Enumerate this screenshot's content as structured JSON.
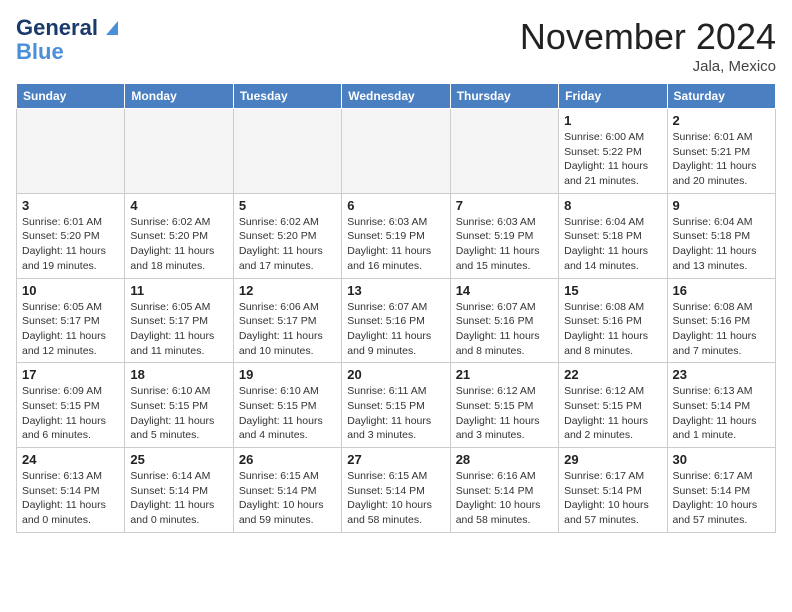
{
  "header": {
    "logo_line1": "General",
    "logo_line2": "Blue",
    "month": "November 2024",
    "location": "Jala, Mexico"
  },
  "weekdays": [
    "Sunday",
    "Monday",
    "Tuesday",
    "Wednesday",
    "Thursday",
    "Friday",
    "Saturday"
  ],
  "weeks": [
    [
      {
        "day": "",
        "info": ""
      },
      {
        "day": "",
        "info": ""
      },
      {
        "day": "",
        "info": ""
      },
      {
        "day": "",
        "info": ""
      },
      {
        "day": "",
        "info": ""
      },
      {
        "day": "1",
        "info": "Sunrise: 6:00 AM\nSunset: 5:22 PM\nDaylight: 11 hours\nand 21 minutes."
      },
      {
        "day": "2",
        "info": "Sunrise: 6:01 AM\nSunset: 5:21 PM\nDaylight: 11 hours\nand 20 minutes."
      }
    ],
    [
      {
        "day": "3",
        "info": "Sunrise: 6:01 AM\nSunset: 5:20 PM\nDaylight: 11 hours\nand 19 minutes."
      },
      {
        "day": "4",
        "info": "Sunrise: 6:02 AM\nSunset: 5:20 PM\nDaylight: 11 hours\nand 18 minutes."
      },
      {
        "day": "5",
        "info": "Sunrise: 6:02 AM\nSunset: 5:20 PM\nDaylight: 11 hours\nand 17 minutes."
      },
      {
        "day": "6",
        "info": "Sunrise: 6:03 AM\nSunset: 5:19 PM\nDaylight: 11 hours\nand 16 minutes."
      },
      {
        "day": "7",
        "info": "Sunrise: 6:03 AM\nSunset: 5:19 PM\nDaylight: 11 hours\nand 15 minutes."
      },
      {
        "day": "8",
        "info": "Sunrise: 6:04 AM\nSunset: 5:18 PM\nDaylight: 11 hours\nand 14 minutes."
      },
      {
        "day": "9",
        "info": "Sunrise: 6:04 AM\nSunset: 5:18 PM\nDaylight: 11 hours\nand 13 minutes."
      }
    ],
    [
      {
        "day": "10",
        "info": "Sunrise: 6:05 AM\nSunset: 5:17 PM\nDaylight: 11 hours\nand 12 minutes."
      },
      {
        "day": "11",
        "info": "Sunrise: 6:05 AM\nSunset: 5:17 PM\nDaylight: 11 hours\nand 11 minutes."
      },
      {
        "day": "12",
        "info": "Sunrise: 6:06 AM\nSunset: 5:17 PM\nDaylight: 11 hours\nand 10 minutes."
      },
      {
        "day": "13",
        "info": "Sunrise: 6:07 AM\nSunset: 5:16 PM\nDaylight: 11 hours\nand 9 minutes."
      },
      {
        "day": "14",
        "info": "Sunrise: 6:07 AM\nSunset: 5:16 PM\nDaylight: 11 hours\nand 8 minutes."
      },
      {
        "day": "15",
        "info": "Sunrise: 6:08 AM\nSunset: 5:16 PM\nDaylight: 11 hours\nand 8 minutes."
      },
      {
        "day": "16",
        "info": "Sunrise: 6:08 AM\nSunset: 5:16 PM\nDaylight: 11 hours\nand 7 minutes."
      }
    ],
    [
      {
        "day": "17",
        "info": "Sunrise: 6:09 AM\nSunset: 5:15 PM\nDaylight: 11 hours\nand 6 minutes."
      },
      {
        "day": "18",
        "info": "Sunrise: 6:10 AM\nSunset: 5:15 PM\nDaylight: 11 hours\nand 5 minutes."
      },
      {
        "day": "19",
        "info": "Sunrise: 6:10 AM\nSunset: 5:15 PM\nDaylight: 11 hours\nand 4 minutes."
      },
      {
        "day": "20",
        "info": "Sunrise: 6:11 AM\nSunset: 5:15 PM\nDaylight: 11 hours\nand 3 minutes."
      },
      {
        "day": "21",
        "info": "Sunrise: 6:12 AM\nSunset: 5:15 PM\nDaylight: 11 hours\nand 3 minutes."
      },
      {
        "day": "22",
        "info": "Sunrise: 6:12 AM\nSunset: 5:15 PM\nDaylight: 11 hours\nand 2 minutes."
      },
      {
        "day": "23",
        "info": "Sunrise: 6:13 AM\nSunset: 5:14 PM\nDaylight: 11 hours\nand 1 minute."
      }
    ],
    [
      {
        "day": "24",
        "info": "Sunrise: 6:13 AM\nSunset: 5:14 PM\nDaylight: 11 hours\nand 0 minutes."
      },
      {
        "day": "25",
        "info": "Sunrise: 6:14 AM\nSunset: 5:14 PM\nDaylight: 11 hours\nand 0 minutes."
      },
      {
        "day": "26",
        "info": "Sunrise: 6:15 AM\nSunset: 5:14 PM\nDaylight: 10 hours\nand 59 minutes."
      },
      {
        "day": "27",
        "info": "Sunrise: 6:15 AM\nSunset: 5:14 PM\nDaylight: 10 hours\nand 58 minutes."
      },
      {
        "day": "28",
        "info": "Sunrise: 6:16 AM\nSunset: 5:14 PM\nDaylight: 10 hours\nand 58 minutes."
      },
      {
        "day": "29",
        "info": "Sunrise: 6:17 AM\nSunset: 5:14 PM\nDaylight: 10 hours\nand 57 minutes."
      },
      {
        "day": "30",
        "info": "Sunrise: 6:17 AM\nSunset: 5:14 PM\nDaylight: 10 hours\nand 57 minutes."
      }
    ]
  ]
}
